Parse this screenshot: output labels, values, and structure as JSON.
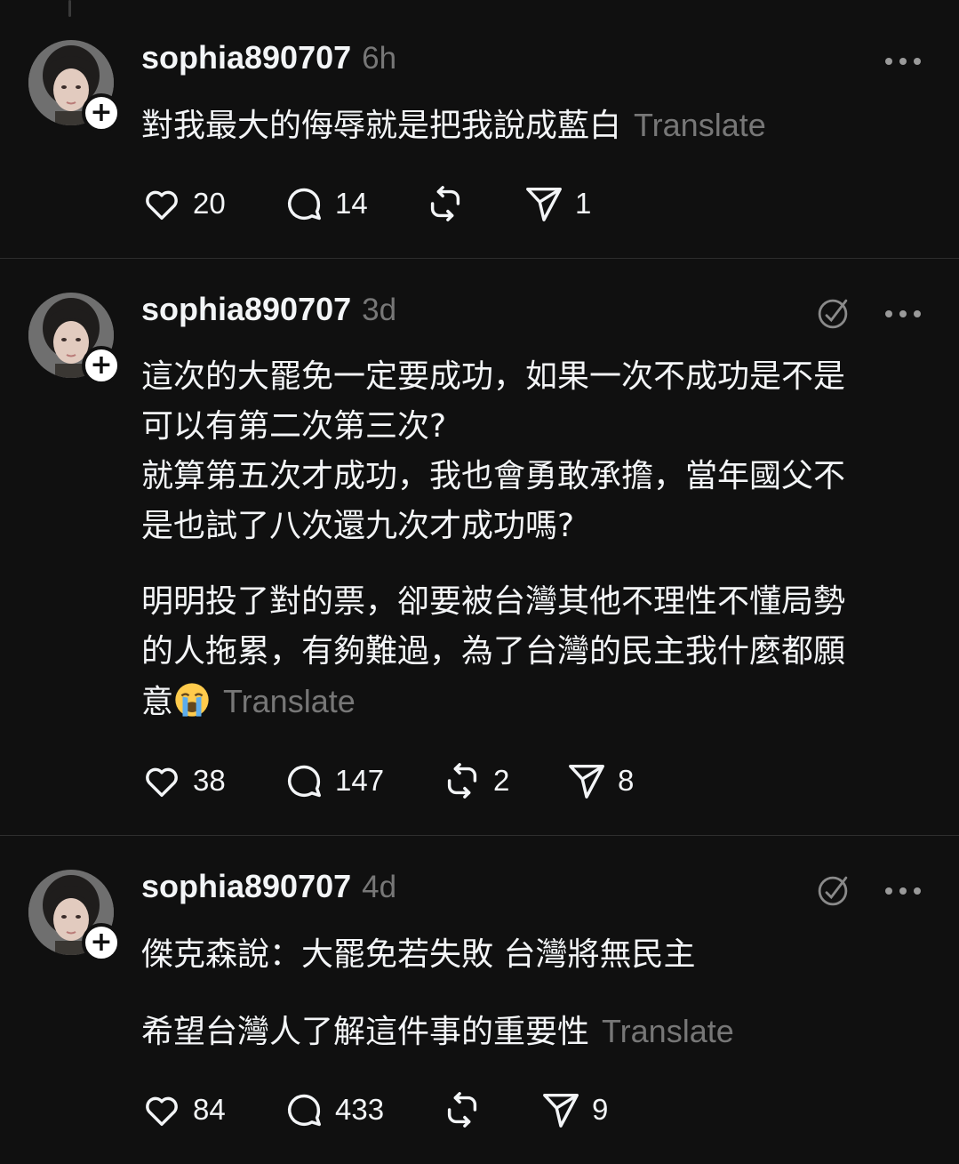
{
  "posts": [
    {
      "username": "sophia890707",
      "time": "6h",
      "lines": [
        "對我最大的侮辱就是把我說成藍白"
      ],
      "translate": "Translate",
      "likes": "20",
      "replies": "14",
      "reposts": "",
      "shares": "1",
      "has_tag_icon": false
    },
    {
      "username": "sophia890707",
      "time": "3d",
      "lines": [
        "這次的大罷免一定要成功，如果一次不成功是不是",
        "可以有第二次第三次?",
        "就算第五次才成功，我也會勇敢承擔，當年國父不",
        "是也試了八次還九次才成功嗎?",
        "明明投了對的票，卻要被台灣其他不理性不懂局勢",
        "的人拖累，有夠難過，為了台灣的民主我什麼都願",
        "意"
      ],
      "emoji": "loudly-crying-face",
      "translate": "Translate",
      "likes": "38",
      "replies": "147",
      "reposts": "2",
      "shares": "8",
      "has_tag_icon": true
    },
    {
      "username": "sophia890707",
      "time": "4d",
      "lines": [
        "傑克森說：大罷免若失敗 台灣將無民主",
        "希望台灣人了解這件事的重要性"
      ],
      "translate": "Translate",
      "likes": "84",
      "replies": "433",
      "reposts": "",
      "shares": "9",
      "has_tag_icon": true
    }
  ],
  "icons": [
    "more-icon",
    "tag-icon",
    "heart-icon",
    "comment-icon",
    "repost-icon",
    "share-icon",
    "follow-plus-icon"
  ]
}
